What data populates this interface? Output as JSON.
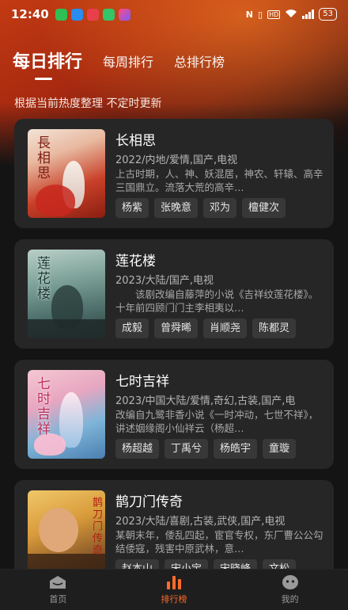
{
  "status_bar": {
    "time": "12:40",
    "battery": "53"
  },
  "tabs": [
    {
      "label": "每日排行",
      "active": true
    },
    {
      "label": "每周排行",
      "active": false
    },
    {
      "label": "总排行榜",
      "active": false
    }
  ],
  "subtitle": "根据当前热度整理 不定时更新",
  "cards": [
    {
      "title": "长相思",
      "meta": "2022/内地/爱情,国产,电视",
      "desc": "上古时期，人、神、妖混居，神农、轩辕、高辛三国鼎立。流落大荒的高辛…",
      "actors": [
        "杨紫",
        "张晚意",
        "邓为",
        "檀健次"
      ],
      "poster_text": "長相思"
    },
    {
      "title": "莲花楼",
      "meta": "2023/大陆/国产,电视",
      "desc": "　　该剧改编自藤萍的小说《吉祥纹莲花楼》。十年前四顾门门主李相夷以…",
      "actors": [
        "成毅",
        "曾舜晞",
        "肖顺尧",
        "陈都灵"
      ],
      "poster_text": "莲花楼"
    },
    {
      "title": "七时吉祥",
      "meta": "2023/中国大陆/爱情,奇幻,古装,国产,电",
      "desc": "改编自九鹭非香小说《一时冲动，七世不祥》，讲述姻缘阁小仙祥云（杨超…",
      "actors": [
        "杨超越",
        "丁禹兮",
        "杨皓宇",
        "童璇"
      ],
      "poster_text": "七时吉祥"
    },
    {
      "title": "鹊刀门传奇",
      "meta": "2023/大陆/喜剧,古装,武侠,国产,电视",
      "desc": "某朝末年，倭乱四起，宦官专权，东厂曹公公勾结倭寇，残害中原武林，意…",
      "actors": [
        "赵本山",
        "宋小宝",
        "宋晓峰",
        "文松"
      ],
      "poster_text": "鹊刀门传奇"
    }
  ],
  "bottom_nav": [
    {
      "label": "首页",
      "icon": "home-icon",
      "active": false
    },
    {
      "label": "排行榜",
      "icon": "ranking-icon",
      "active": true
    },
    {
      "label": "我的",
      "icon": "profile-icon",
      "active": false
    }
  ],
  "colors": {
    "accent": "#ff6a2a",
    "card_bg": "#262626",
    "page_bg": "#141414"
  }
}
